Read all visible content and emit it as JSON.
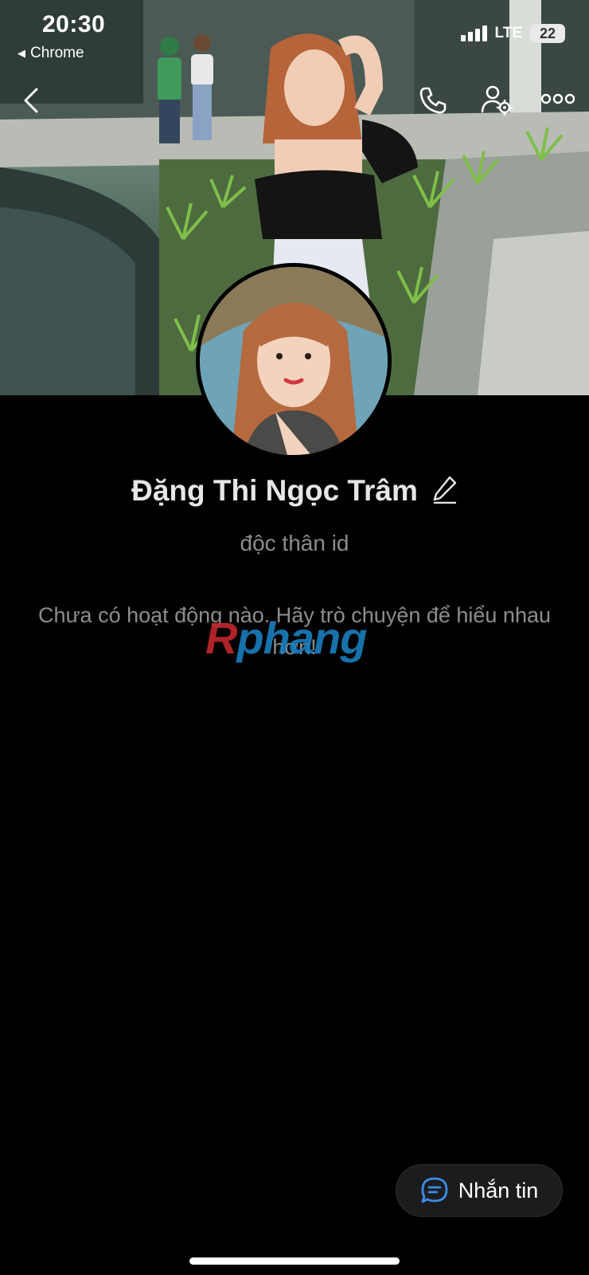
{
  "status_bar": {
    "time": "20:30",
    "back_app": "Chrome",
    "network": "LTE",
    "battery": "22"
  },
  "profile": {
    "name": "Đặng Thi Ngọc Trâm",
    "bio": "độc thân id",
    "activity_text": "Chưa có hoạt động nào. Hãy trò chuyện để hiểu nhau hơn!"
  },
  "watermark": {
    "part1": "R",
    "part2": "phang"
  },
  "actions": {
    "message_label": "Nhắn tin"
  },
  "icons": {
    "back": "chevron-left-icon",
    "call": "phone-icon",
    "settings": "user-gear-icon",
    "more": "more-dots-icon",
    "edit": "pencil-icon",
    "message": "chat-bubble-icon"
  },
  "colors": {
    "background": "#000000",
    "accent": "#3b8de8",
    "muted_text": "#8d8d8d"
  }
}
